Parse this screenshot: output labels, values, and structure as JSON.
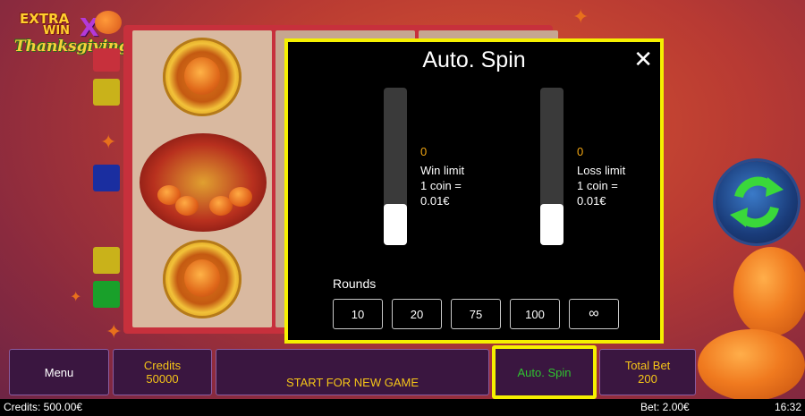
{
  "game": {
    "logo": {
      "line1": "EXTRA",
      "line2": "WIN",
      "x": "X",
      "line3": "Thanksgiving"
    }
  },
  "modal": {
    "title": "Auto. Spin",
    "close_icon": "close-icon",
    "win_limit": {
      "value": "0",
      "label": "Win limit",
      "coin_line": "1 coin =",
      "coin_value": "0.01€"
    },
    "loss_limit": {
      "value": "0",
      "label": "Loss limit",
      "coin_line": "1 coin =",
      "coin_value": "0.01€"
    },
    "rounds_label": "Rounds",
    "rounds": [
      "10",
      "20",
      "75",
      "100",
      "∞"
    ]
  },
  "bottom_bar": {
    "menu": "Menu",
    "credits_label": "Credits",
    "credits_value": "50000",
    "start": "START FOR NEW GAME",
    "autospin": "Auto. Spin",
    "totalbet_label": "Total Bet",
    "totalbet_value": "200"
  },
  "status": {
    "credits": "Credits: 500.00€",
    "bet": "Bet: 2.00€",
    "time": "16:32"
  },
  "colors": {
    "highlight": "#f5f000",
    "accent_gold": "#f5c518",
    "autospin_text": "#2fc42f"
  }
}
